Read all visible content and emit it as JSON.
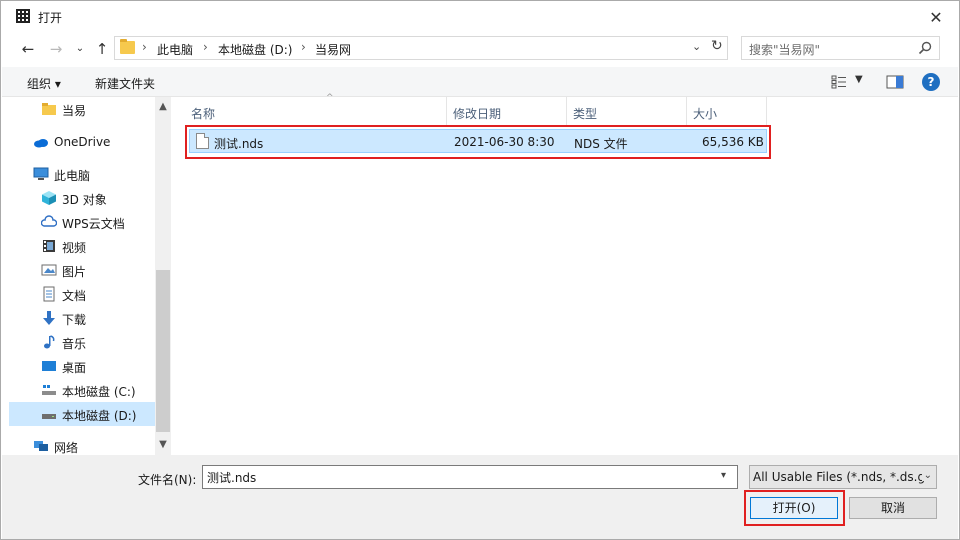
{
  "window": {
    "title": "打开"
  },
  "address": {
    "crumbs": [
      "此电脑",
      "本地磁盘 (D:)",
      "当易网"
    ]
  },
  "search": {
    "placeholder": "搜索\"当易网\""
  },
  "toolbar": {
    "organize_label": "组织 ▾",
    "new_folder_label": "新建文件夹"
  },
  "nav": {
    "items": [
      {
        "label": "当易",
        "icon": "folder-icon"
      },
      {
        "label": "OneDrive",
        "icon": "cloud-icon"
      },
      {
        "label": "此电脑",
        "icon": "computer-icon"
      },
      {
        "label": "3D 对象",
        "icon": "cube-icon"
      },
      {
        "label": "WPS云文档",
        "icon": "wps-cloud-icon"
      },
      {
        "label": "视频",
        "icon": "video-icon"
      },
      {
        "label": "图片",
        "icon": "pictures-icon"
      },
      {
        "label": "文档",
        "icon": "document-icon"
      },
      {
        "label": "下载",
        "icon": "download-icon"
      },
      {
        "label": "音乐",
        "icon": "music-icon"
      },
      {
        "label": "桌面",
        "icon": "desktop-icon"
      },
      {
        "label": "本地磁盘 (C:)",
        "icon": "drive-c-icon"
      },
      {
        "label": "本地磁盘 (D:)",
        "icon": "drive-d-icon",
        "selected": true
      },
      {
        "label": "网络",
        "icon": "network-icon"
      }
    ]
  },
  "filelist": {
    "columns": [
      "名称",
      "修改日期",
      "类型",
      "大小"
    ],
    "rows": [
      {
        "name": "测试.nds",
        "modified": "2021-06-30 8:30",
        "type": "NDS 文件",
        "size": "65,536 KB"
      }
    ]
  },
  "footer": {
    "filename_label": "文件名(N):",
    "filename_value": "测试.nds",
    "filter_value": "All Usable Files (*.nds, *.ds.g",
    "open_label": "打开(O)",
    "cancel_label": "取消"
  },
  "colors": {
    "selection": "#cce8ff",
    "highlight": "#e02020",
    "accent": "#0078d7"
  }
}
